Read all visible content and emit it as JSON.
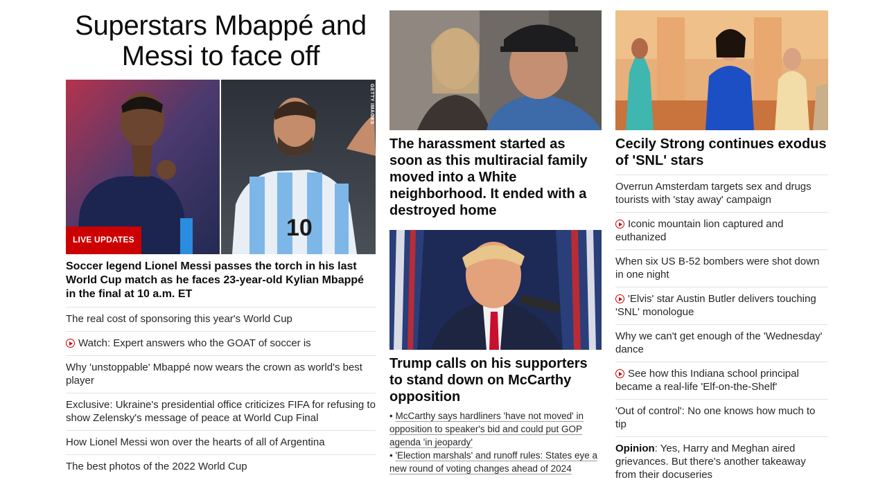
{
  "lead": {
    "title": "Superstars Mbappé and Messi to face off",
    "photo_credit": "GETTY IMAGES",
    "badge": "LIVE UPDATES",
    "description": "Soccer legend Lionel Messi passes the torch in his last World Cup match as he faces 23-year-old Kylian Mbappé in the final at 10 a.m. ET",
    "links": [
      {
        "text": "The real cost of sponsoring this year's World Cup",
        "video": false
      },
      {
        "text": "Watch: Expert answers who the GOAT of soccer is",
        "video": true
      },
      {
        "text": "Why 'unstoppable' Mbappé now wears the crown as world's best player",
        "video": false
      },
      {
        "text": "Exclusive: Ukraine's presidential office criticizes FIFA for refusing to show Zelensky's message of peace at World Cup Final",
        "video": false
      },
      {
        "text": "How Lionel Messi won over the hearts of all of Argentina",
        "video": false
      },
      {
        "text": "The best photos of the 2022 World Cup",
        "video": false
      }
    ]
  },
  "middle": {
    "story1": {
      "headline": "The harassment started as soon as this multiracial family moved into a White neighborhood. It ended with a destroyed home"
    },
    "story2": {
      "headline": "Trump calls on his supporters to stand down on McCarthy opposition",
      "bullets": [
        "McCarthy says hardliners 'have not moved' in opposition to speaker's bid and could put GOP agenda 'in jeopardy'",
        "'Election marshals' and runoff rules: States eye a new round of voting changes ahead of 2024"
      ]
    }
  },
  "right": {
    "headline": "Cecily Strong continues exodus of 'SNL' stars",
    "links": [
      {
        "text": "Overrun Amsterdam targets sex and drugs tourists with 'stay away' campaign",
        "video": false
      },
      {
        "text": "Iconic mountain lion captured and euthanized",
        "video": true
      },
      {
        "text": "When six US B-52 bombers were shot down in one night",
        "video": false
      },
      {
        "text": "'Elvis' star Austin Butler delivers touching 'SNL' monologue",
        "video": true
      },
      {
        "text": "Why we can't get enough of the 'Wednesday' dance",
        "video": false
      },
      {
        "text": "See how this Indiana school principal became a real-life 'Elf-on-the-Shelf'",
        "video": true
      },
      {
        "text": "'Out of control': No one knows how much to tip",
        "video": false
      }
    ],
    "opinion": {
      "label": "Opinion",
      "text": ": Yes, Harry and Meghan aired grievances. But there's another takeaway from their docuseries"
    }
  },
  "colors": {
    "accent": "#cc0000",
    "text": "#0c0c0c",
    "divider": "#e2e2e2"
  },
  "icons": [
    "play-icon"
  ]
}
